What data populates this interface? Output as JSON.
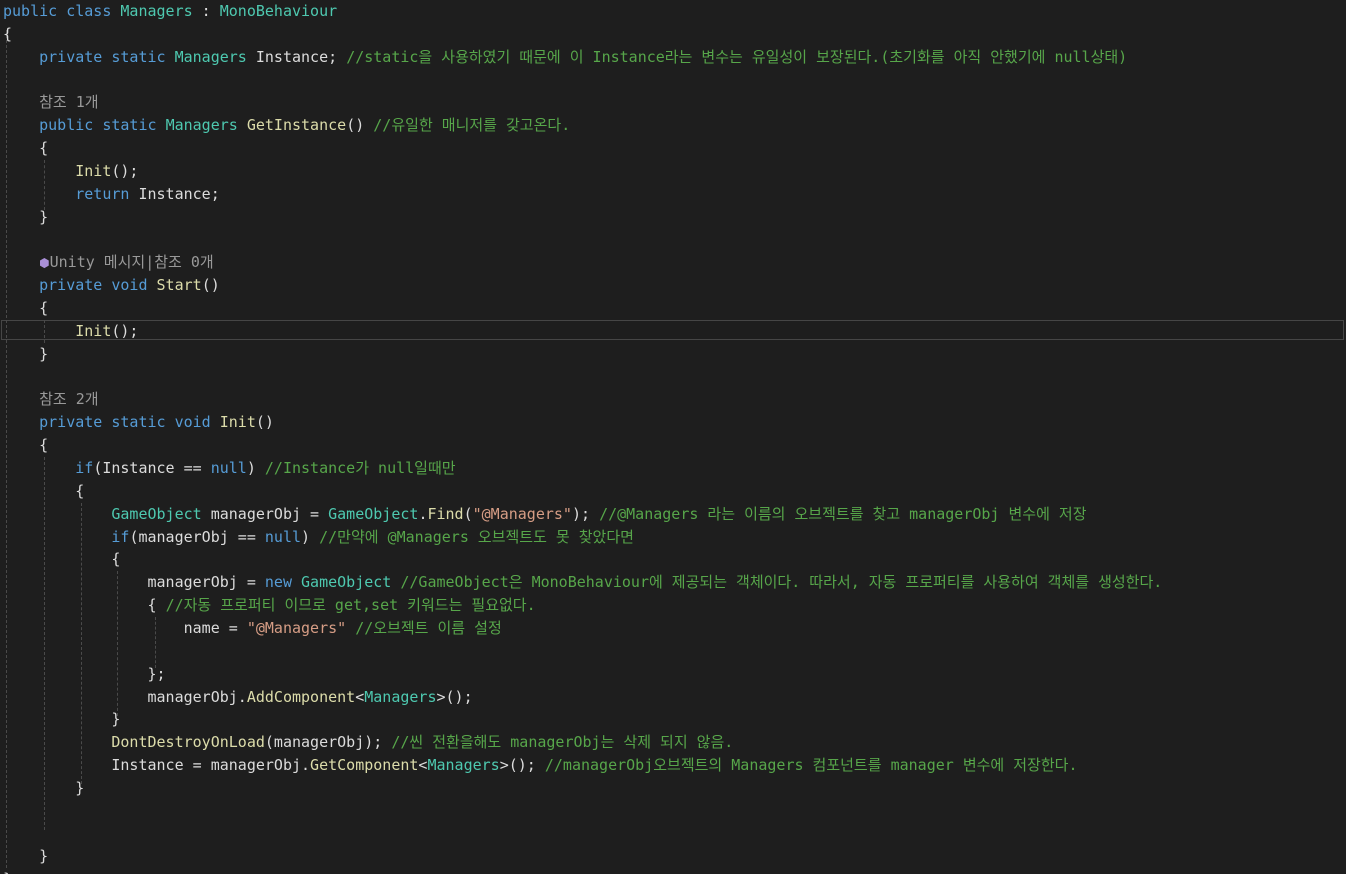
{
  "editor": {
    "colors": {
      "background": "#1e1e1e",
      "keyword": "#569cd6",
      "type": "#4ec9b0",
      "function": "#dcdcaa",
      "comment": "#57a64a",
      "string": "#d69d85",
      "codelens": "#999999",
      "text": "#dcdcdc"
    },
    "lines": [
      {
        "tokens": [
          [
            "kw",
            "public class "
          ],
          [
            "ty",
            "Managers"
          ],
          [
            "p",
            " : "
          ],
          [
            "ty",
            "MonoBehaviour"
          ]
        ]
      },
      {
        "tokens": [
          [
            "p",
            "{"
          ]
        ]
      },
      {
        "tokens": [
          [
            "p",
            "    "
          ],
          [
            "kw",
            "private static "
          ],
          [
            "ty",
            "Managers"
          ],
          [
            "p",
            " Instance; "
          ],
          [
            "cm",
            "//static을 사용하였기 때문에 이 Instance라는 변수는 유일성이 보장된다.(초기화를 아직 안했기에 null상태)"
          ]
        ]
      },
      {
        "tokens": []
      },
      {
        "tokens": [
          [
            "lens",
            "    참조 1개"
          ]
        ]
      },
      {
        "tokens": [
          [
            "p",
            "    "
          ],
          [
            "kw",
            "public static "
          ],
          [
            "ty",
            "Managers"
          ],
          [
            "p",
            " "
          ],
          [
            "fn",
            "GetInstance"
          ],
          [
            "p",
            "() "
          ],
          [
            "cm",
            "//유일한 매니저를 갖고온다."
          ]
        ]
      },
      {
        "tokens": [
          [
            "p",
            "    {"
          ]
        ]
      },
      {
        "tokens": [
          [
            "p",
            "        "
          ],
          [
            "fn",
            "Init"
          ],
          [
            "p",
            "();"
          ]
        ]
      },
      {
        "tokens": [
          [
            "p",
            "        "
          ],
          [
            "kw",
            "return"
          ],
          [
            "p",
            " Instance;"
          ]
        ]
      },
      {
        "tokens": [
          [
            "p",
            "    }"
          ]
        ]
      },
      {
        "tokens": []
      },
      {
        "tokens": [
          [
            "lens",
            "    "
          ],
          [
            "icon",
            "⬢"
          ],
          [
            "lens",
            "Unity 메시지|참조 0개"
          ]
        ]
      },
      {
        "tokens": [
          [
            "p",
            "    "
          ],
          [
            "kw",
            "private void "
          ],
          [
            "fn",
            "Start"
          ],
          [
            "p",
            "()"
          ]
        ]
      },
      {
        "tokens": [
          [
            "p",
            "    {"
          ]
        ]
      },
      {
        "tokens": [
          [
            "p",
            "        "
          ],
          [
            "fn",
            "Init"
          ],
          [
            "p",
            "();"
          ]
        ]
      },
      {
        "tokens": [
          [
            "p",
            "    }"
          ]
        ]
      },
      {
        "tokens": []
      },
      {
        "tokens": [
          [
            "lens",
            "    참조 2개"
          ]
        ]
      },
      {
        "tokens": [
          [
            "p",
            "    "
          ],
          [
            "kw",
            "private static void "
          ],
          [
            "fn",
            "Init"
          ],
          [
            "p",
            "()"
          ]
        ]
      },
      {
        "tokens": [
          [
            "p",
            "    {"
          ]
        ]
      },
      {
        "tokens": [
          [
            "p",
            "        "
          ],
          [
            "kw",
            "if"
          ],
          [
            "p",
            "(Instance == "
          ],
          [
            "kw",
            "null"
          ],
          [
            "p",
            ") "
          ],
          [
            "cm",
            "//Instance가 null일때만"
          ]
        ]
      },
      {
        "tokens": [
          [
            "p",
            "        {"
          ]
        ]
      },
      {
        "tokens": [
          [
            "p",
            "            "
          ],
          [
            "ty",
            "GameObject"
          ],
          [
            "p",
            " managerObj = "
          ],
          [
            "ty",
            "GameObject"
          ],
          [
            "p",
            "."
          ],
          [
            "fn",
            "Find"
          ],
          [
            "p",
            "("
          ],
          [
            "st",
            "\"@Managers\""
          ],
          [
            "p",
            "); "
          ],
          [
            "cm",
            "//@Managers 라는 이름의 오브젝트를 찾고 managerObj 변수에 저장"
          ]
        ]
      },
      {
        "tokens": [
          [
            "p",
            "            "
          ],
          [
            "kw",
            "if"
          ],
          [
            "p",
            "(managerObj == "
          ],
          [
            "kw",
            "null"
          ],
          [
            "p",
            ") "
          ],
          [
            "cm",
            "//만약에 @Managers 오브젝트도 못 찾았다면"
          ]
        ]
      },
      {
        "tokens": [
          [
            "p",
            "            {"
          ]
        ]
      },
      {
        "tokens": [
          [
            "p",
            "                managerObj = "
          ],
          [
            "kw",
            "new "
          ],
          [
            "ty",
            "GameObject"
          ],
          [
            "p",
            " "
          ],
          [
            "cm",
            "//GameObject은 MonoBehaviour에 제공되는 객체이다. 따라서, 자동 프로퍼티를 사용하여 객체를 생성한다."
          ]
        ]
      },
      {
        "tokens": [
          [
            "p",
            "                { "
          ],
          [
            "cm",
            "//자동 프로퍼티 이므로 get,set 키워드는 필요없다."
          ]
        ]
      },
      {
        "tokens": [
          [
            "p",
            "                    name = "
          ],
          [
            "st",
            "\"@Managers\""
          ],
          [
            "p",
            " "
          ],
          [
            "cm",
            "//오브젝트 이름 설정"
          ]
        ]
      },
      {
        "tokens": []
      },
      {
        "tokens": [
          [
            "p",
            "                };"
          ]
        ]
      },
      {
        "tokens": [
          [
            "p",
            "                managerObj."
          ],
          [
            "fn",
            "AddComponent"
          ],
          [
            "p",
            "<"
          ],
          [
            "ty",
            "Managers"
          ],
          [
            "p",
            ">();"
          ]
        ]
      },
      {
        "tokens": [
          [
            "p",
            "            }"
          ]
        ]
      },
      {
        "tokens": [
          [
            "p",
            "            "
          ],
          [
            "fn",
            "DontDestroyOnLoad"
          ],
          [
            "p",
            "(managerObj); "
          ],
          [
            "cm",
            "//씬 전환을해도 managerObj는 삭제 되지 않음."
          ]
        ]
      },
      {
        "tokens": [
          [
            "p",
            "            Instance = managerObj."
          ],
          [
            "fn",
            "GetComponent"
          ],
          [
            "p",
            "<"
          ],
          [
            "ty",
            "Managers"
          ],
          [
            "p",
            ">(); "
          ],
          [
            "cm",
            "//managerObj오브젝트의 Managers 컴포넌트를 manager 변수에 저장한다."
          ]
        ]
      },
      {
        "tokens": [
          [
            "p",
            "        }"
          ]
        ]
      },
      {
        "tokens": []
      },
      {
        "tokens": []
      },
      {
        "tokens": [
          [
            "p",
            "    }"
          ]
        ]
      },
      {
        "tokens": [
          [
            "p",
            "}"
          ]
        ]
      }
    ]
  }
}
